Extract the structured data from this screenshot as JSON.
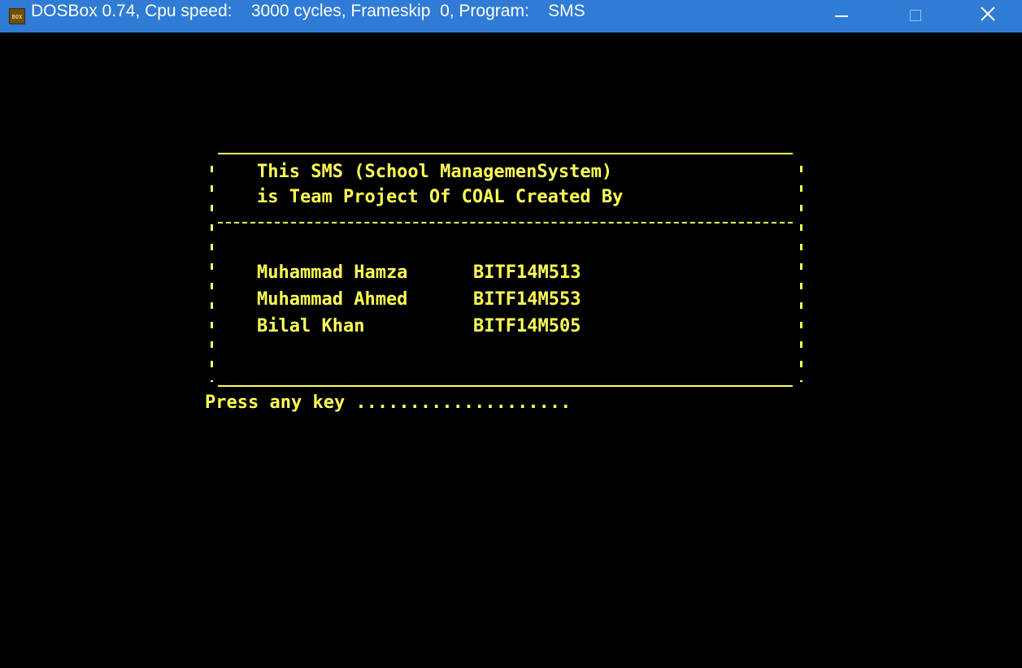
{
  "window": {
    "title": "DOSBox 0.74, Cpu speed:    3000 cycles, Frameskip  0, Program:    SMS",
    "icon_label": "BOX",
    "icons": {
      "app": "dosbox-app-icon",
      "minimize": "minimize-icon",
      "maximize": "maximize-icon",
      "close": "close-icon"
    },
    "colors": {
      "titlebar": "#2f7bd6",
      "console_bg": "#000000",
      "console_text": "#ffff55"
    }
  },
  "screen": {
    "header_line1": "This SMS (School ManagemenSystem)",
    "header_line2": "is Team Project Of COAL Created By",
    "members": [
      {
        "name": "Muhammad Hamza",
        "roll": "BITF14M513"
      },
      {
        "name": "Muhammad Ahmed",
        "roll": "BITF14M553"
      },
      {
        "name": "Bilal Khan",
        "roll": "BITF14M505"
      }
    ],
    "prompt": "Press any key ...................."
  }
}
